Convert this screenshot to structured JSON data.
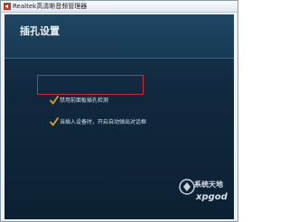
{
  "window": {
    "title": "Realtek高清晰音频管理器"
  },
  "page": {
    "title": "插孔设置"
  },
  "options": [
    {
      "label": "禁用前面板插孔检测",
      "checked": true,
      "highlighted": true
    },
    {
      "label": "当插入设备时，开启自动弹出对话框",
      "checked": true,
      "highlighted": false
    }
  ],
  "watermark": {
    "line1": "系统天地",
    "line2": "xpgod"
  },
  "colors": {
    "panel_bg": "#10283e",
    "checkbox_check": "#d9a520",
    "highlight_border": "#d8262e"
  }
}
